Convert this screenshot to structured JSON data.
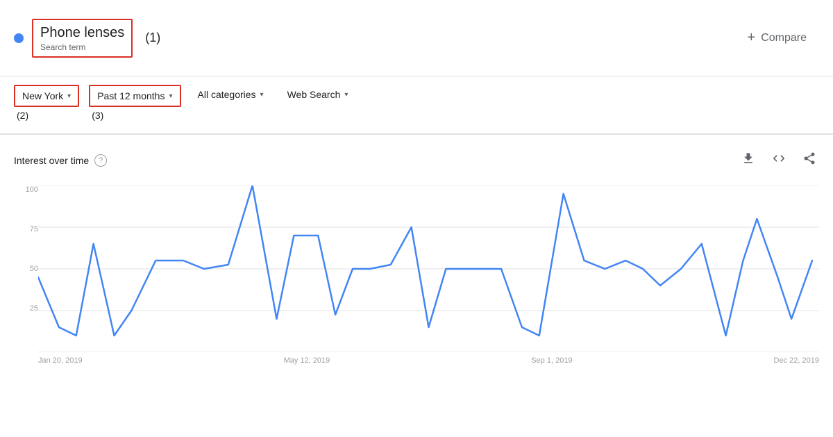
{
  "header": {
    "search_term": "Phone lenses",
    "search_term_sub": "Search term",
    "label_num": "(1)",
    "compare_label": "Compare",
    "compare_plus": "+"
  },
  "filters": {
    "location": {
      "label": "New York",
      "num": "(2)"
    },
    "time_range": {
      "label": "Past 12 months",
      "num": "(3)"
    },
    "categories": {
      "label": "All categories"
    },
    "search_type": {
      "label": "Web Search"
    }
  },
  "chart": {
    "title": "Interest over time",
    "help": "?",
    "y_labels": [
      "100",
      "75",
      "50",
      "25"
    ],
    "x_labels": [
      "Jan 20, 2019",
      "May 12, 2019",
      "Sep 1, 2019",
      "Dec 22, 2019"
    ],
    "download_icon": "⬇",
    "embed_icon": "<>",
    "share_icon": "⟨"
  }
}
